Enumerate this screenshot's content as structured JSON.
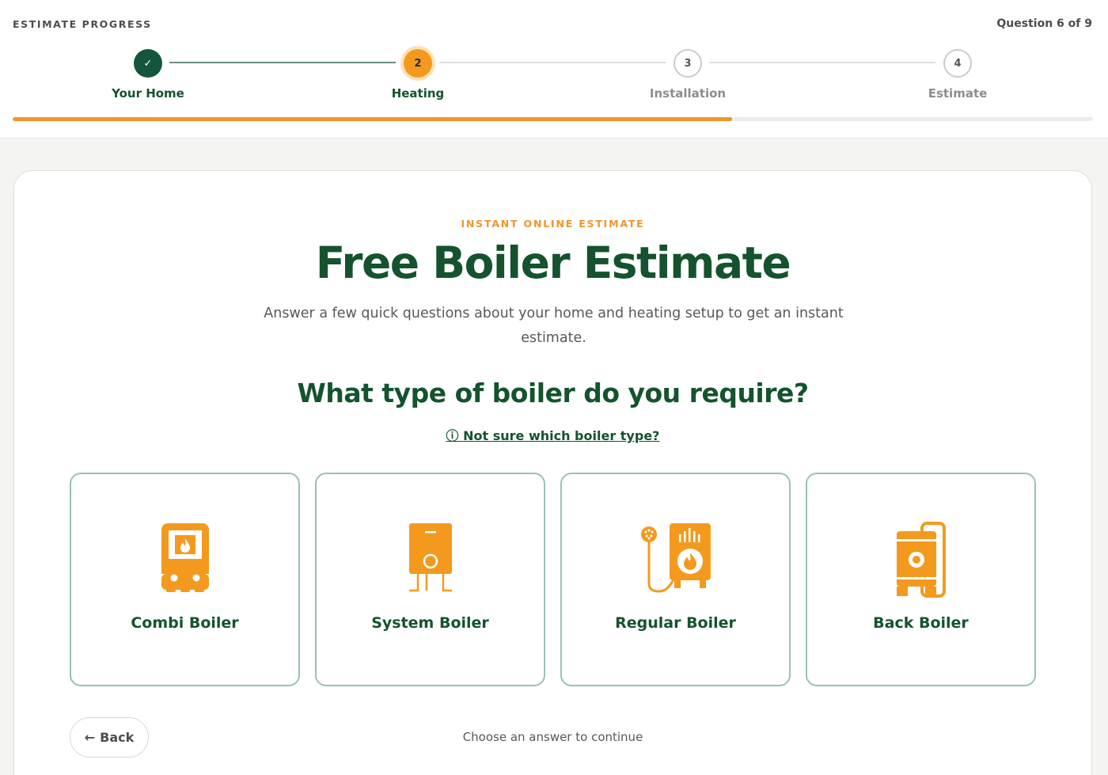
{
  "progress": {
    "label": "ESTIMATE PROGRESS",
    "question_count": "Question 6 of 9",
    "percent_complete": 66.6,
    "steps": [
      {
        "number": "✓",
        "label": "Your Home",
        "state": "complete"
      },
      {
        "number": "2",
        "label": "Heating",
        "state": "active"
      },
      {
        "number": "3",
        "label": "Installation",
        "state": "pending"
      },
      {
        "number": "4",
        "label": "Estimate",
        "state": "pending"
      }
    ]
  },
  "card": {
    "eyebrow": "INSTANT ONLINE ESTIMATE",
    "title": "Free Boiler Estimate",
    "subtitle": "Answer a few quick questions about your home and heating setup to get an instant estimate.",
    "question": "What type of boiler do you require?",
    "help_icon": "ⓘ",
    "help_link": "Not sure which boiler type?",
    "options": [
      {
        "label": "Combi Boiler",
        "icon": "combi-boiler-icon"
      },
      {
        "label": "System Boiler",
        "icon": "system-boiler-icon"
      },
      {
        "label": "Regular Boiler",
        "icon": "regular-boiler-icon"
      },
      {
        "label": "Back Boiler",
        "icon": "back-boiler-icon"
      }
    ],
    "back_label": "Back",
    "back_icon": "←",
    "continue_hint": "Choose an answer to continue"
  },
  "colors": {
    "brand_green": "#14532d",
    "accent_orange": "#f39a1e",
    "card_border": "#9cc1b2"
  }
}
